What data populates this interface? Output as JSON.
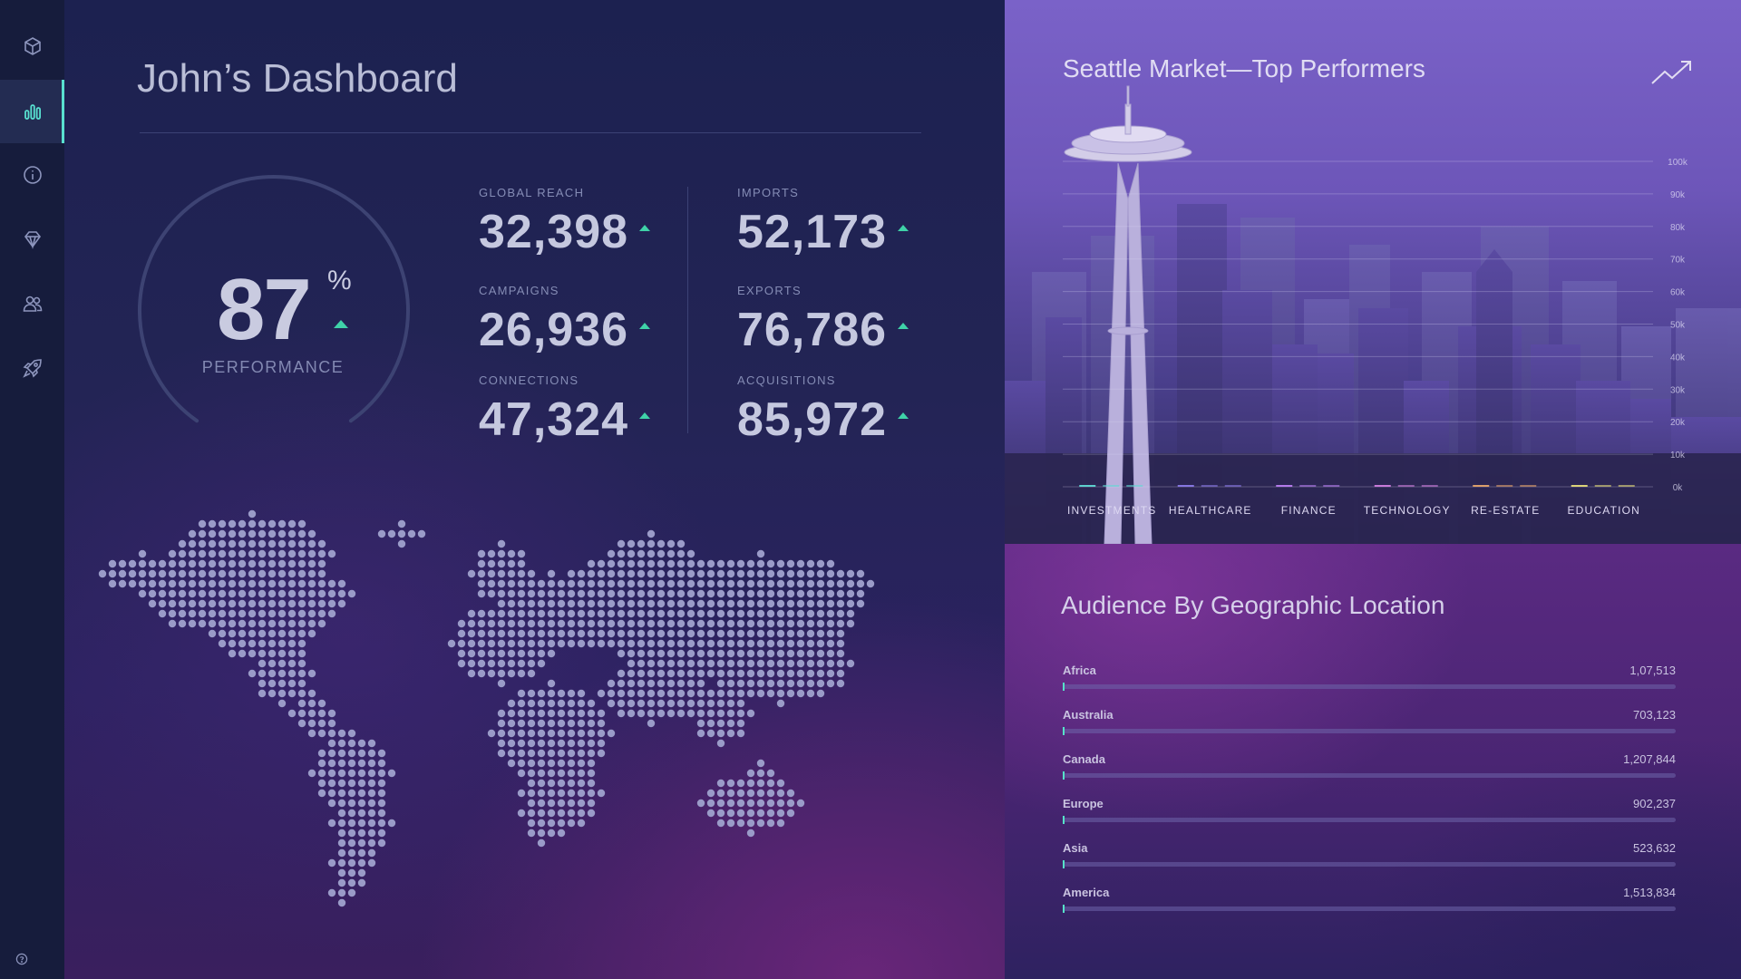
{
  "colors": {
    "accent": "#58e0d0",
    "up_arrow": "#3fd2a8",
    "sidebar_bg": "#161c3c",
    "text_primary": "#c5c8df"
  },
  "sidebar": {
    "items": [
      {
        "icon": "cube-icon",
        "active": false
      },
      {
        "icon": "bar-chart-icon",
        "active": true
      },
      {
        "icon": "info-icon",
        "active": false
      },
      {
        "icon": "diamond-icon",
        "active": false
      },
      {
        "icon": "users-icon",
        "active": false
      },
      {
        "icon": "rocket-icon",
        "active": false
      }
    ],
    "help_icon": "help-icon"
  },
  "header": {
    "title": "John’s Dashboard"
  },
  "performance": {
    "value": "87",
    "unit": "%",
    "label": "PERFORMANCE",
    "fraction": 0.87
  },
  "stats": [
    {
      "label": "GLOBAL REACH",
      "value": "32,398",
      "trend": "up"
    },
    {
      "label": "CAMPAIGNS",
      "value": "26,936",
      "trend": "up"
    },
    {
      "label": "CONNECTIONS",
      "value": "47,324",
      "trend": "up"
    },
    {
      "label": "IMPORTS",
      "value": "52,173",
      "trend": "up"
    },
    {
      "label": "EXPORTS",
      "value": "76,786",
      "trend": "up"
    },
    {
      "label": "ACQUISITIONS",
      "value": "85,972",
      "trend": "up"
    }
  ],
  "market_chart": {
    "title": "Seattle Market—Top Performers",
    "icon": "trend-up-icon"
  },
  "chart_data": {
    "type": "bar",
    "title": "Seattle Market—Top Performers",
    "categories": [
      "INVESTMENTS",
      "HEALTHCARE",
      "FINANCE",
      "TECHNOLOGY",
      "RE-ESTATE",
      "EDUCATION"
    ],
    "series": [
      {
        "values": [
          0,
          0,
          0,
          0,
          0,
          0
        ],
        "color": "#5fd8d4"
      }
    ],
    "category_colors": [
      "#5fd8d4",
      "#8a7ae8",
      "#b97ef2",
      "#d07ee0",
      "#e5a46b",
      "#e6dc7a"
    ],
    "y_ticks": [
      "0k",
      "10k",
      "20k",
      "30k",
      "40k",
      "50k",
      "60k",
      "70k",
      "80k",
      "90k",
      "100k"
    ],
    "ylim": [
      0,
      100000
    ],
    "grid": true,
    "xlabel": "",
    "ylabel": ""
  },
  "audience": {
    "title": "Audience By Geographic Location",
    "rows": [
      {
        "name": "Africa",
        "value": "1,07,513",
        "fraction": 0.0
      },
      {
        "name": "Australia",
        "value": "703,123",
        "fraction": 0.0
      },
      {
        "name": "Canada",
        "value": "1,207,844",
        "fraction": 0.0
      },
      {
        "name": "Europe",
        "value": "902,237",
        "fraction": 0.0
      },
      {
        "name": "Asia",
        "value": "523,632",
        "fraction": 0.0
      },
      {
        "name": "America",
        "value": "1,513,834",
        "fraction": 0.0
      }
    ]
  }
}
